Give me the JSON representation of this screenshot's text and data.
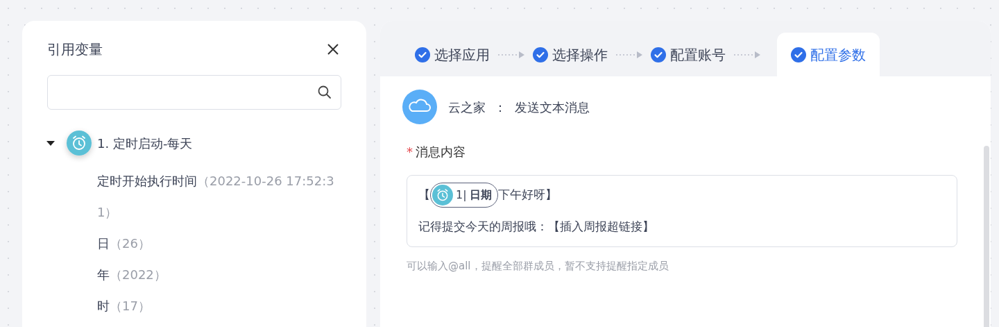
{
  "variables_panel": {
    "title": "引用变量",
    "groups": [
      {
        "label": "1. 定时启动-每天",
        "expanded": true,
        "children": [
          {
            "name": "定时开始执行时间",
            "value": "（2022-10-26 17:52:31）"
          },
          {
            "name": "日",
            "value": "（26）"
          },
          {
            "name": "年",
            "value": "（2022）"
          },
          {
            "name": "时",
            "value": "（17）"
          }
        ]
      }
    ]
  },
  "steps": [
    {
      "label": "选择应用",
      "selected": false
    },
    {
      "label": "选择操作",
      "selected": false
    },
    {
      "label": "配置账号",
      "selected": false
    },
    {
      "label": "配置参数",
      "selected": true
    }
  ],
  "action": {
    "app": "云之家",
    "separator": "：",
    "name": "发送文本消息"
  },
  "field": {
    "label": "消息内容",
    "required_mark": "*",
    "lines": [
      {
        "segments": [
          {
            "kind": "text",
            "text": "【"
          },
          {
            "kind": "variable",
            "index": "1|",
            "label": "日期"
          },
          {
            "kind": "text",
            "text": "下午好呀】"
          }
        ]
      },
      {
        "segments": [
          {
            "kind": "text",
            "text": "记得提交今天的周报哦：【插入周报超链接】"
          }
        ]
      }
    ],
    "hint": "可以输入@all，提醒全部群成员，暂不支持提醒指定成员"
  }
}
